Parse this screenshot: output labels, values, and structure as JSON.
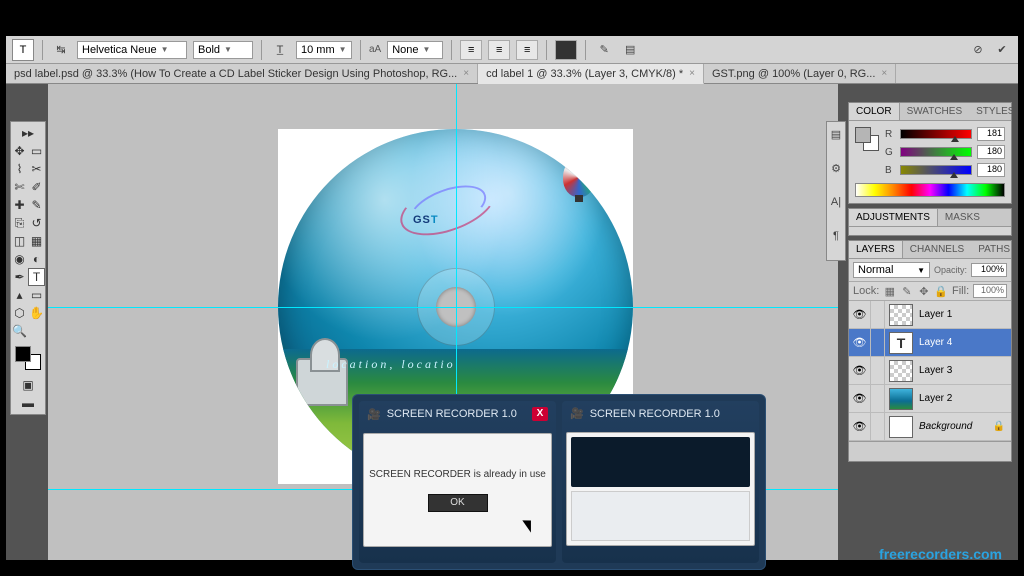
{
  "options_bar": {
    "font_family": "Helvetica Neue",
    "font_style": "Bold",
    "font_size": "10 mm",
    "aa_label": "aA",
    "aa_value": "None"
  },
  "doc_tabs": [
    {
      "label": "psd label.psd @ 33.3% (How To Create  a CD Label Sticker Design Using Photoshop, RG...",
      "active": false
    },
    {
      "label": "cd label 1 @ 33.3% (Layer 3, CMYK/8) *",
      "active": true
    },
    {
      "label": "GST.png @ 100% (Layer 0, RG...",
      "active": false
    }
  ],
  "artwork": {
    "logo_main": "GS",
    "logo_accent": "T",
    "tagline": "location, locatio"
  },
  "color_panel": {
    "tabs": [
      "COLOR",
      "SWATCHES",
      "STYLES"
    ],
    "channels": [
      {
        "label": "R",
        "value": "181",
        "pos": 71
      },
      {
        "label": "G",
        "value": "180",
        "pos": 70
      },
      {
        "label": "B",
        "value": "180",
        "pos": 70
      }
    ]
  },
  "adjustments_panel": {
    "tabs": [
      "ADJUSTMENTS",
      "MASKS"
    ]
  },
  "layers_panel": {
    "tabs": [
      "LAYERS",
      "CHANNELS",
      "PATHS"
    ],
    "blend_mode": "Normal",
    "opacity_label": "Opacity:",
    "opacity_value": "100%",
    "lock_label": "Lock:",
    "fill_label": "Fill:",
    "fill_value": "100%",
    "layers": [
      {
        "name": "Layer 1",
        "kind": "trans"
      },
      {
        "name": "Layer 4",
        "kind": "T",
        "selected": true
      },
      {
        "name": "Layer 3",
        "kind": "trans"
      },
      {
        "name": "Layer 2",
        "kind": "img"
      },
      {
        "name": "Background",
        "kind": "white",
        "locked": true,
        "bg": true
      }
    ]
  },
  "recorder": {
    "title": "SCREEN RECORDER 1.0",
    "message": "SCREEN RECORDER is already in use",
    "ok": "OK"
  },
  "watermark": "freerecorders.com"
}
